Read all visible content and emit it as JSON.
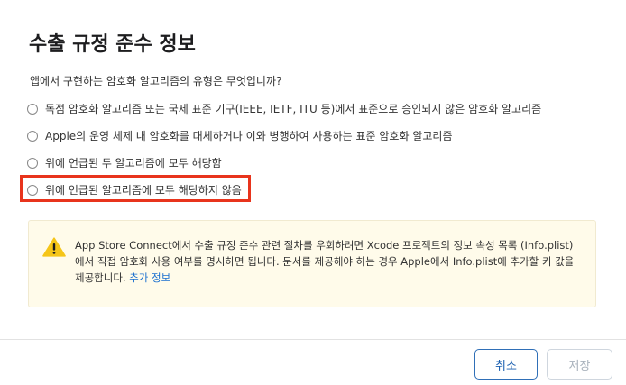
{
  "dialog": {
    "title": "수출 규정 준수 정보",
    "question": "앱에서 구현하는 암호화 알고리즘의 유형은 무엇입니까?",
    "options": [
      {
        "label": "독점 암호화 알고리즘 또는 국제 표준 기구(IEEE, IETF, ITU 등)에서 표준으로 승인되지 않은 암호화 알고리즘",
        "selected": false
      },
      {
        "label": "Apple의 운영 체제 내 암호화를 대체하거나 이와 병행하여 사용하는 표준 암호화 알고리즘",
        "selected": false
      },
      {
        "label": "위에 언급된 두 알고리즘에 모두 해당함",
        "selected": false
      },
      {
        "label": "위에 언급된 알고리즘에 모두 해당하지 않음",
        "selected": false
      }
    ],
    "highlight_color": "#e8341c"
  },
  "notice": {
    "icon": "warning-icon",
    "text": "App Store Connect에서 수출 규정 준수 관련 절차를 우회하려면 Xcode 프로젝트의 정보 속성 목록 (Info.plist)에서 직접 암호화 사용 여부를 명시하면 됩니다. 문서를 제공해야 하는 경우 Apple에서 Info.plist에 추가할 키 값을 제공합니다. ",
    "link_label": "추가 정보",
    "background_color": "#fffbea",
    "icon_color": "#f5c518"
  },
  "footer": {
    "cancel_label": "취소",
    "save_label": "저장",
    "accent_color": "#1a5fb0"
  }
}
